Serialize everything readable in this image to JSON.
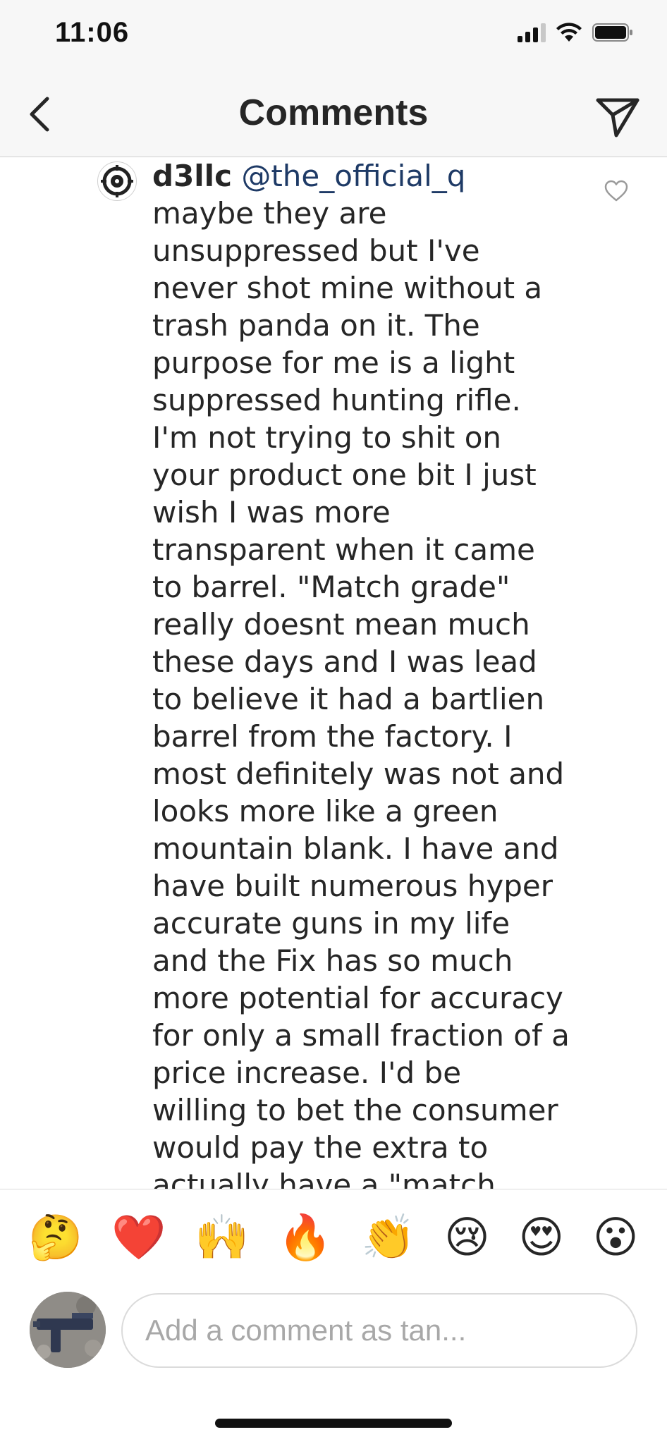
{
  "status_bar": {
    "time": "11:06"
  },
  "nav": {
    "title": "Comments"
  },
  "comment": {
    "username": "d3llc",
    "mention": "@the_official_q",
    "text": "maybe they are\nunsuppressed but I've\nnever shot mine without a\ntrash panda on it.  The\npurpose for me is a light\nsuppressed hunting rifle.\nI'm not trying to shit on\nyour product one bit I just\nwish I was more\ntransparent when it came\nto barrel. \"Match grade\"\nreally doesnt mean much\nthese days and I was lead\nto believe it had a bartlien\nbarrel from the factory.  I\nmost definitely was not and\nlooks more like a green\nmountain blank.  I have and\nhave built numerous hyper\naccurate guns in my life\nand the Fix has so much\nmore potential for accuracy\nfor only a small fraction of a\nprice increase.  I'd be\nwilling to bet the consumer\nwould pay the extra to\nactually have a \"match"
  },
  "emoji_bar": {
    "items": [
      {
        "name": "thinking-face",
        "char": "🤔"
      },
      {
        "name": "red-heart",
        "char": "❤️"
      },
      {
        "name": "raising-hands",
        "char": "🙌"
      },
      {
        "name": "fire",
        "char": "🔥"
      },
      {
        "name": "clapping-hands",
        "char": "👏"
      },
      {
        "name": "crying-face",
        "char": "😢"
      },
      {
        "name": "heart-eyes",
        "char": "😍"
      },
      {
        "name": "surprised-face",
        "char": "😮"
      }
    ]
  },
  "input": {
    "placeholder": "Add a comment as tan..."
  },
  "icons": {
    "back": "chevron-left-icon",
    "send": "paper-plane-icon",
    "like": "heart-outline-icon",
    "signal": "cellular-signal-icon",
    "wifi": "wifi-icon",
    "battery": "battery-icon"
  },
  "colors": {
    "mention": "#1e3a66",
    "text": "#262626",
    "placeholder": "#a8a8a8"
  }
}
